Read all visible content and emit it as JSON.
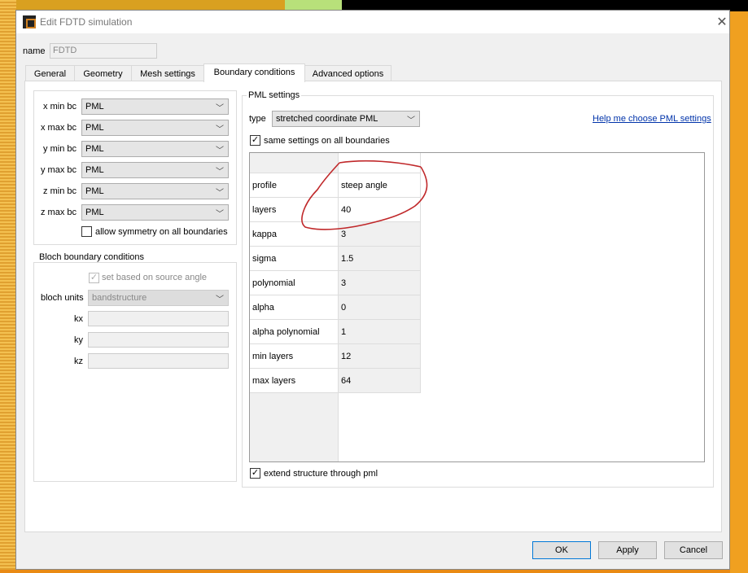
{
  "window": {
    "title": "Edit FDTD simulation",
    "close_icon": "close-icon"
  },
  "name": {
    "label": "name",
    "value": "FDTD"
  },
  "tabs": [
    {
      "label": "General"
    },
    {
      "label": "Geometry"
    },
    {
      "label": "Mesh settings"
    },
    {
      "label": "Boundary conditions",
      "active": true
    },
    {
      "label": "Advanced options"
    }
  ],
  "bc": {
    "rows": [
      {
        "label": "x min bc",
        "value": "PML"
      },
      {
        "label": "x max bc",
        "value": "PML"
      },
      {
        "label": "y min bc",
        "value": "PML"
      },
      {
        "label": "y max bc",
        "value": "PML"
      },
      {
        "label": "z min bc",
        "value": "PML"
      },
      {
        "label": "z max bc",
        "value": "PML"
      }
    ],
    "allow_symmetry": {
      "label": "allow symmetry on all boundaries",
      "checked": false
    }
  },
  "bloch": {
    "title": "Bloch boundary conditions",
    "set_based": {
      "label": "set based on source angle",
      "checked": true
    },
    "units_label": "bloch units",
    "units_value": "bandstructure",
    "kx": "kx",
    "ky": "ky",
    "kz": "kz"
  },
  "pml": {
    "title": "PML settings",
    "type_label": "type",
    "type_value": "stretched coordinate PML",
    "help_link": "Help me choose PML settings",
    "same_settings": {
      "label": "same settings on all boundaries",
      "checked": true
    },
    "rows": [
      {
        "name": "profile",
        "value": "steep angle"
      },
      {
        "name": "layers",
        "value": "40"
      },
      {
        "name": "kappa",
        "value": "3"
      },
      {
        "name": "sigma",
        "value": "1.5"
      },
      {
        "name": "polynomial",
        "value": "3"
      },
      {
        "name": "alpha",
        "value": "0"
      },
      {
        "name": "alpha polynomial",
        "value": "1"
      },
      {
        "name": "min layers",
        "value": "12"
      },
      {
        "name": "max layers",
        "value": "64"
      }
    ],
    "extend": {
      "label": "extend structure through pml",
      "checked": true
    }
  },
  "buttons": {
    "ok": "OK",
    "apply": "Apply",
    "cancel": "Cancel"
  },
  "annotation_color": "#c0282a"
}
